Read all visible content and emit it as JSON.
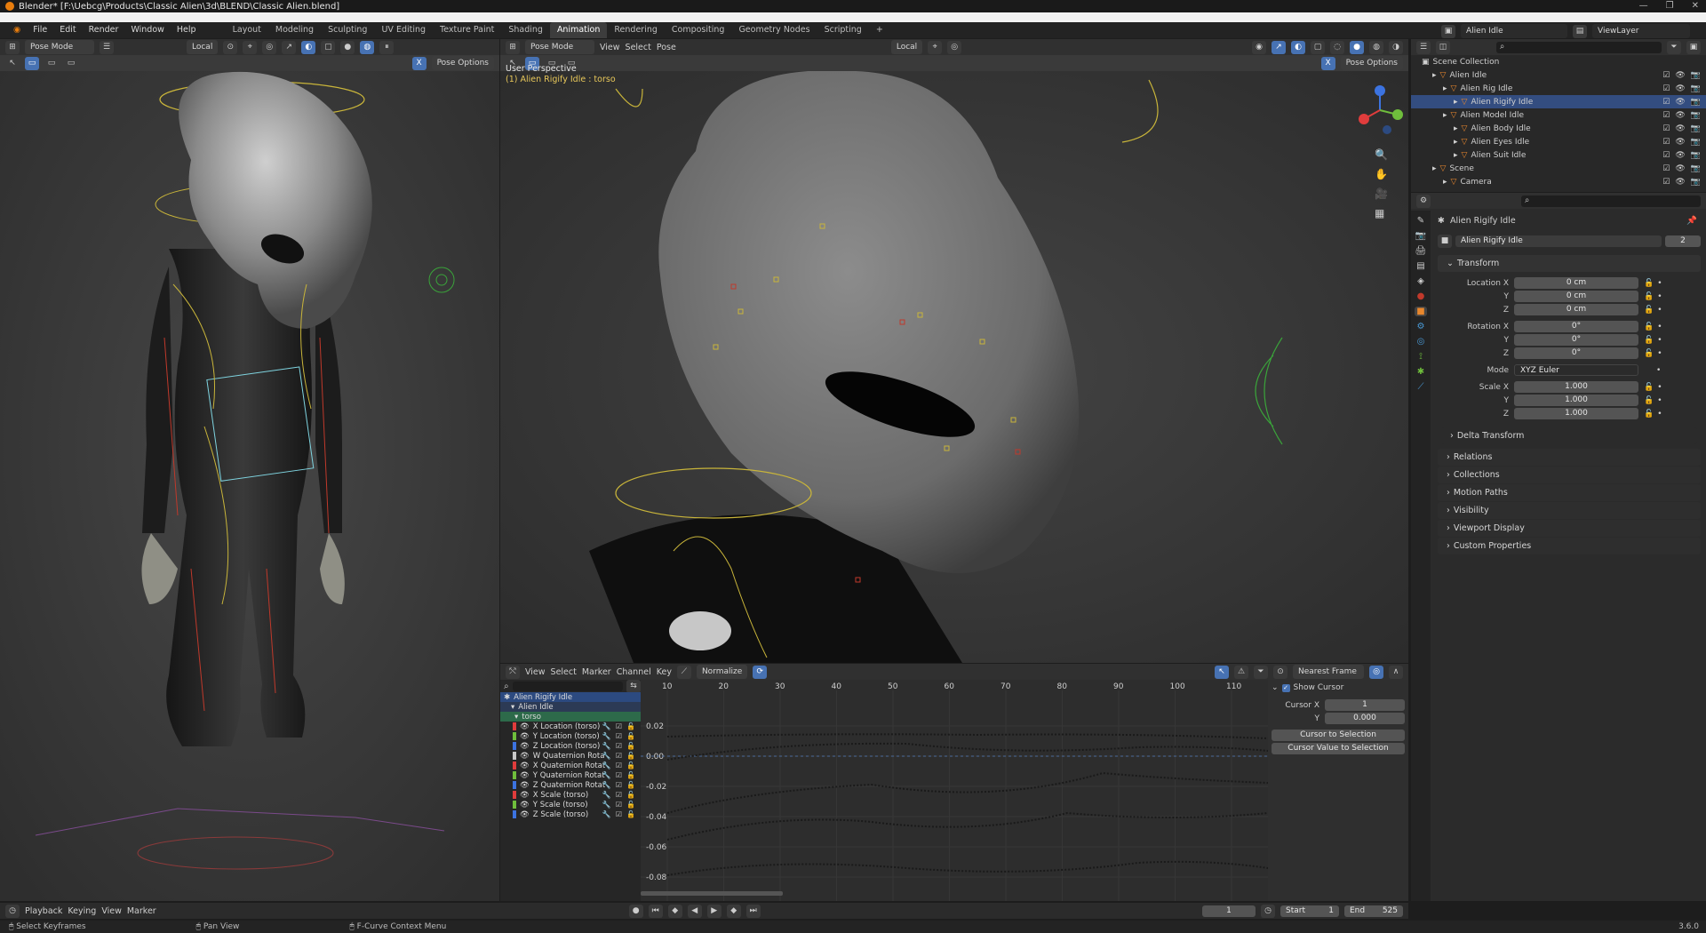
{
  "window": {
    "title": "Blender* [F:\\Uebcg\\Products\\Classic Alien\\3d\\BLEND\\Classic Alien.blend]",
    "minimize": "—",
    "maximize": "❐",
    "close": "✕"
  },
  "menu": [
    "File",
    "Edit",
    "Render",
    "Window",
    "Help"
  ],
  "workspaces": [
    "Layout",
    "Modeling",
    "Sculpting",
    "UV Editing",
    "Texture Paint",
    "Shading",
    "Animation",
    "Rendering",
    "Compositing",
    "Geometry Nodes",
    "Scripting"
  ],
  "active_workspace": "Animation",
  "scene_selector": "Alien Idle",
  "view_layer": "ViewLayer",
  "left_viewport": {
    "mode": "Pose Mode",
    "orientation": "Local",
    "pose_options": "Pose Options"
  },
  "main_viewport": {
    "mode": "Pose Mode",
    "menus": [
      "View",
      "Select",
      "Pose"
    ],
    "orientation": "Local",
    "pose_options": "Pose Options",
    "overlay_title": "User Perspective",
    "overlay_sub": "(1) Alien Rigify Idle : torso"
  },
  "outliner": {
    "root": "Scene Collection",
    "rows": [
      {
        "label": "Alien Idle",
        "indent": 1
      },
      {
        "label": "Alien Rig Idle",
        "indent": 2
      },
      {
        "label": "Alien Rigify Idle",
        "indent": 3,
        "selected": true
      },
      {
        "label": "Alien Model Idle",
        "indent": 2
      },
      {
        "label": "Alien Body Idle",
        "indent": 3
      },
      {
        "label": "Alien Eyes Idle",
        "indent": 3
      },
      {
        "label": "Alien Suit Idle",
        "indent": 3
      },
      {
        "label": "Scene",
        "indent": 1
      },
      {
        "label": "Camera",
        "indent": 2
      }
    ]
  },
  "properties": {
    "object_name": "Alien Rigify Idle",
    "data_name": "Alien Rigify Idle",
    "users": "2",
    "transform_label": "Transform",
    "location": {
      "label_x": "Location X",
      "x": "0 cm",
      "y": "0 cm",
      "z": "0 cm"
    },
    "rotation": {
      "label_x": "Rotation X",
      "x": "0°",
      "y": "0°",
      "z": "0°"
    },
    "mode_label": "Mode",
    "mode_value": "XYZ Euler",
    "scale": {
      "label_x": "Scale X",
      "x": "1.000",
      "y": "1.000",
      "z": "1.000"
    },
    "axis_y": "Y",
    "axis_z": "Z",
    "delta": "Delta Transform",
    "panels": [
      "Relations",
      "Collections",
      "Motion Paths",
      "Visibility",
      "Viewport Display",
      "Custom Properties"
    ]
  },
  "graph": {
    "menus": [
      "View",
      "Select",
      "Marker",
      "Channel",
      "Key"
    ],
    "normalize": "Normalize",
    "snap": "Nearest Frame",
    "frame_ticks": [
      "10",
      "20",
      "30",
      "40",
      "50",
      "60",
      "70",
      "80",
      "90",
      "100",
      "110"
    ],
    "value_ticks": [
      "0.02",
      "0.00",
      "-0.02",
      "-0.04",
      "-0.06",
      "-0.08"
    ],
    "channels_top": [
      "Alien Rigify Idle",
      "Alien Idle",
      "torso"
    ],
    "channels": [
      {
        "label": "X Location (torso)",
        "color": "#e03c3c"
      },
      {
        "label": "Y Location (torso)",
        "color": "#6fbe3c"
      },
      {
        "label": "Z Location (torso)",
        "color": "#3c73e0"
      },
      {
        "label": "W Quaternion Rota",
        "color": "#c8c8c8"
      },
      {
        "label": "X Quaternion Rotat",
        "color": "#e03c3c"
      },
      {
        "label": "Y Quaternion Rotat",
        "color": "#6fbe3c"
      },
      {
        "label": "Z Quaternion Rotat",
        "color": "#3c73e0"
      },
      {
        "label": "X Scale (torso)",
        "color": "#e03c3c"
      },
      {
        "label": "Y Scale (torso)",
        "color": "#6fbe3c"
      },
      {
        "label": "Z Scale (torso)",
        "color": "#3c73e0"
      }
    ],
    "sidebar": {
      "show_cursor": "Show Cursor",
      "cursor_x_label": "Cursor X",
      "cursor_x": "1",
      "cursor_y_label": "Y",
      "cursor_y": "0.000",
      "to_selection": "Cursor to Selection",
      "value_to_selection": "Cursor Value to Selection"
    }
  },
  "timeline": {
    "menus": [
      "Playback",
      "Keying",
      "View",
      "Marker"
    ],
    "current_frame": "1",
    "start_label": "Start",
    "start": "1",
    "end_label": "End",
    "end": "525"
  },
  "statusbar": {
    "items": [
      "Select Keyframes",
      "Pan View",
      "F-Curve Context Menu"
    ],
    "version": "3.6.0"
  }
}
